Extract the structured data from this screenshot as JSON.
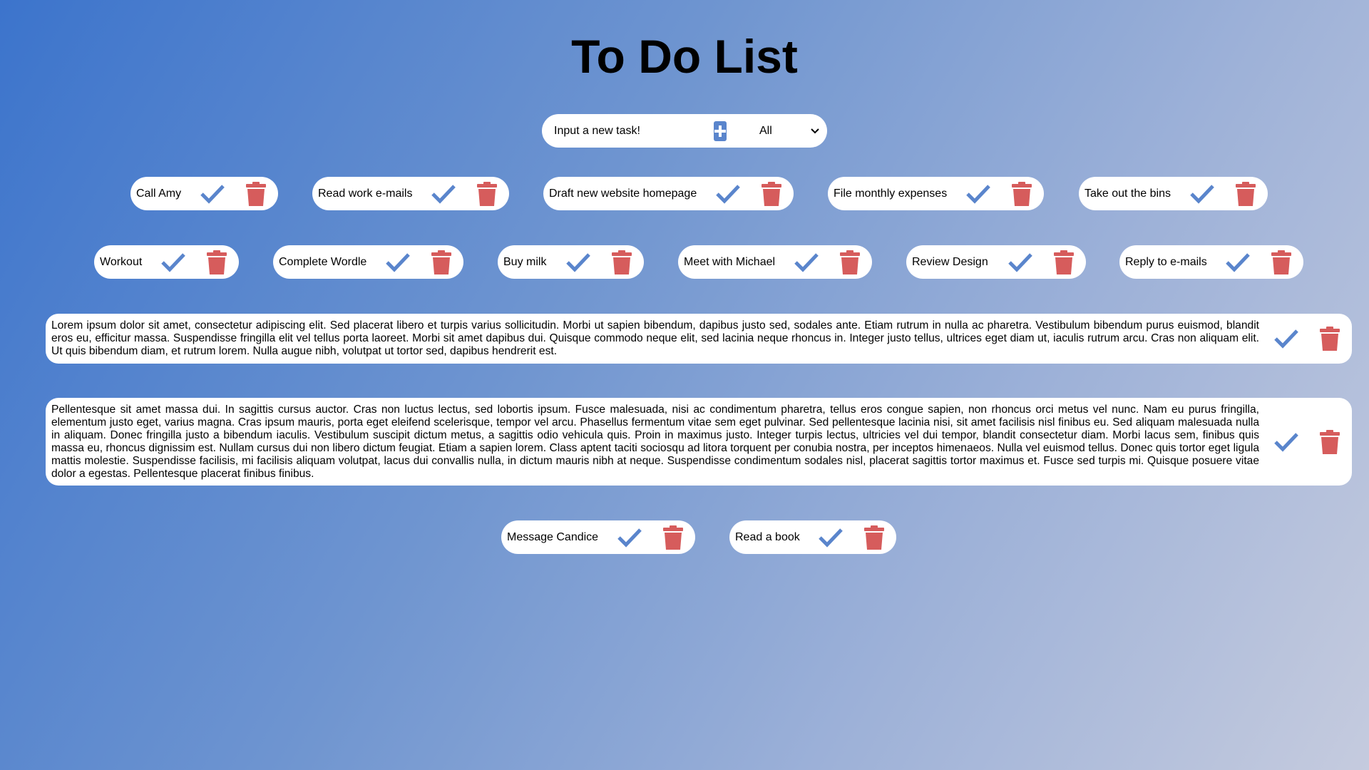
{
  "page": {
    "title": "To Do List"
  },
  "controls": {
    "input_placeholder": "Input a new task!",
    "add_icon": "plus-square-icon",
    "filter_selected": "All",
    "filter_options": [
      "All"
    ]
  },
  "colors": {
    "accent": "#5a85cc",
    "delete": "#d65c5c",
    "background_start": "#3c74cc",
    "background_end": "#c5cbde"
  },
  "tasks": [
    {
      "text": "Call Amy"
    },
    {
      "text": "Read work e-mails"
    },
    {
      "text": "Draft new website homepage"
    },
    {
      "text": "File monthly expenses"
    },
    {
      "text": "Take out the bins"
    },
    {
      "text": "Workout"
    },
    {
      "text": "Complete Wordle"
    },
    {
      "text": "Buy milk"
    },
    {
      "text": "Meet with Michael"
    },
    {
      "text": "Review Design"
    },
    {
      "text": "Reply to e-mails"
    },
    {
      "text": "Lorem ipsum dolor sit amet, consectetur adipiscing elit. Sed placerat libero et turpis varius sollicitudin. Morbi ut sapien bibendum, dapibus justo sed, sodales ante. Etiam rutrum in nulla ac pharetra. Vestibulum bibendum purus euismod, blandit eros eu, efficitur massa. Suspendisse fringilla elit vel tellus porta laoreet. Morbi sit amet dapibus dui. Quisque commodo neque elit, sed lacinia neque rhoncus in. Integer justo tellus, ultrices eget diam ut, iaculis rutrum arcu. Cras non aliquam elit. Ut quis bibendum diam, et rutrum lorem. Nulla augue nibh, volutpat ut tortor sed, dapibus hendrerit est."
    },
    {
      "text": "Pellentesque sit amet massa dui. In sagittis cursus auctor. Cras non luctus lectus, sed lobortis ipsum. Fusce malesuada, nisi ac condimentum pharetra, tellus eros congue sapien, non rhoncus orci metus vel nunc. Nam eu purus fringilla, elementum justo eget, varius magna. Cras ipsum mauris, porta eget eleifend scelerisque, tempor vel arcu. Phasellus fermentum vitae sem eget pulvinar. Sed pellentesque lacinia nisi, sit amet facilisis nisl finibus eu. Sed aliquam malesuada nulla in aliquam. Donec fringilla justo a bibendum iaculis. Vestibulum suscipit dictum metus, a sagittis odio vehicula quis. Proin in maximus justo. Integer turpis lectus, ultricies vel dui tempor, blandit consectetur diam. Morbi lacus sem, finibus quis massa eu, rhoncus dignissim est. Nullam cursus dui non libero dictum feugiat. Etiam a sapien lorem. Class aptent taciti sociosqu ad litora torquent per conubia nostra, per inceptos himenaeos. Nulla vel euismod tellus. Donec quis tortor eget ligula mattis molestie. Suspendisse facilisis, mi facilisis aliquam volutpat, lacus dui convallis nulla, in dictum mauris nibh at neque. Suspendisse condimentum sodales nisl, placerat sagittis tortor maximus et. Fusce sed turpis mi. Quisque posuere vitae dolor a egestas. Pellentesque placerat finibus finibus."
    },
    {
      "text": "Message Candice"
    },
    {
      "text": "Read a book"
    }
  ],
  "task_icons": {
    "complete": "check-icon",
    "delete": "trash-icon"
  }
}
